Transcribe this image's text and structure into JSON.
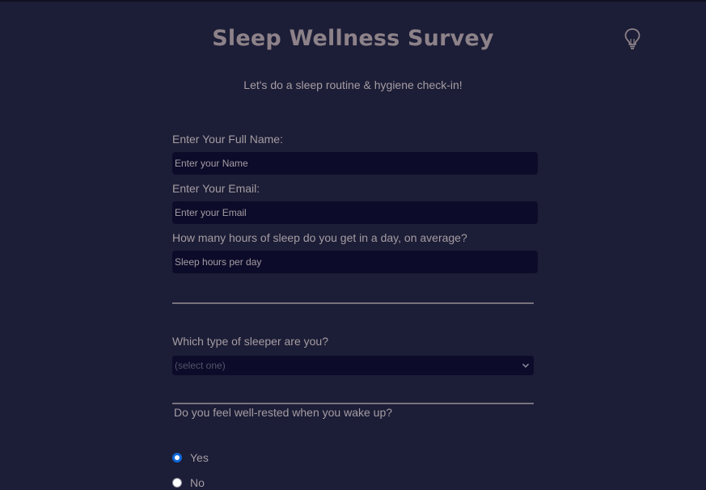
{
  "header": {
    "title": "Sleep Wellness Survey",
    "subtitle": "Let's do a sleep routine & hygiene check-in!",
    "theme_icon": "lightbulb-icon"
  },
  "form": {
    "name": {
      "label": "Enter Your Full Name:",
      "placeholder": "Enter your Name",
      "value": ""
    },
    "email": {
      "label": "Enter Your Email:",
      "placeholder": "Enter your Email",
      "value": ""
    },
    "hours": {
      "label": "How many hours of sleep do you get in a day, on average?",
      "placeholder": "Sleep hours per day",
      "value": ""
    },
    "sleeper_type": {
      "label": "Which type of sleeper are you?",
      "selected": "(select one)",
      "icon": "chevron-down-icon"
    },
    "well_rested": {
      "label": "Do you feel well-rested when you wake up?",
      "options": [
        "Yes",
        "No"
      ],
      "selected": "Yes"
    }
  },
  "colors": {
    "background": "#1c1d36",
    "field_background": "#0c0b29",
    "title": "#8d8289",
    "text": "#a59da4",
    "radio_accent": "#0f67d8"
  }
}
